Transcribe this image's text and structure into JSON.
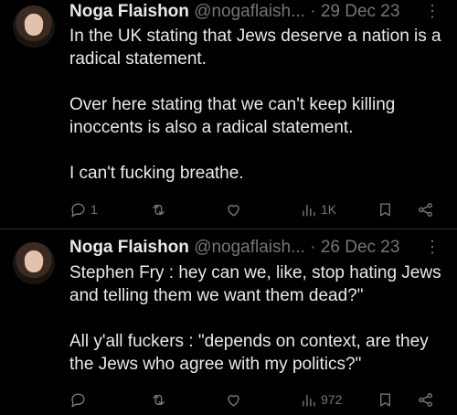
{
  "tweets": [
    {
      "name": "Noga Flaishon",
      "handle": "@nogaflaish...",
      "separator": "·",
      "date": "29 Dec 23",
      "more": "⋮",
      "paragraphs": [
        "In the UK stating that Jews deserve a nation is a radical statement.",
        "Over here stating that we can't keep killing inoccents is also a radical statement.",
        "I can't fucking breathe."
      ],
      "replies": "1",
      "views": "1K"
    },
    {
      "name": "Noga Flaishon",
      "handle": "@nogaflaish...",
      "separator": "·",
      "date": "26 Dec 23",
      "more": "⋮",
      "paragraphs": [
        "Stephen Fry : hey can we, like, stop hating Jews and telling them we want them dead?\"",
        "All y'all fuckers : \"depends on context, are they the Jews who agree with my politics?\""
      ],
      "replies": "",
      "views": "972"
    }
  ],
  "icons": [
    "reply-icon",
    "retweet-icon",
    "like-icon",
    "views-icon",
    "bookmark-icon",
    "share-icon"
  ],
  "colors": {
    "background": "#000000",
    "text": "#e7e9ea",
    "muted": "#71767b",
    "divider": "#2f3336"
  }
}
